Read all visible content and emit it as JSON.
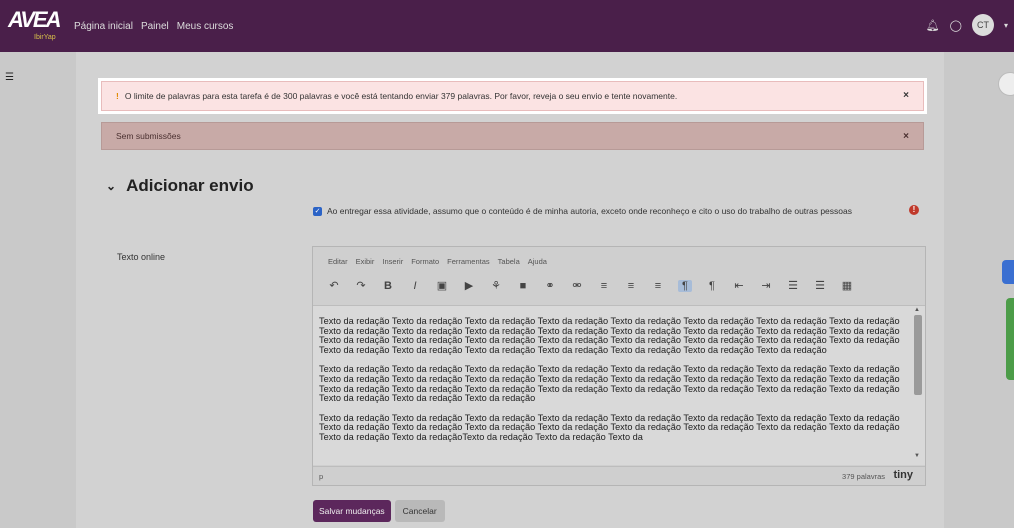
{
  "navbar": {
    "logo_text": "AVEA",
    "logo_sub": "IbirYap",
    "links": [
      "Página inicial",
      "Painel",
      "Meus cursos"
    ],
    "bell_icon": "bell-icon",
    "chat_icon": "chat-icon",
    "avatar_initials": "CT"
  },
  "alerts": {
    "error_text": "O limite de palavras para esta tarefa é de 300 palavras e você está tentando enviar 379 palavras. Por favor, reveja o seu envio e tente novamente.",
    "error_bang": "!",
    "nosub_text": "Sem submissões",
    "close": "×"
  },
  "section": {
    "title": "Adicionar envio",
    "chevron": "⌄"
  },
  "consent": {
    "text": "Ao entregar essa atividade, assumo que o conteúdo é de minha autoria, exceto onde reconheço e cito o uso do trabalho de outras pessoas",
    "required": "!"
  },
  "field": {
    "label": "Texto online"
  },
  "editor": {
    "menu": [
      "Editar",
      "Exibir",
      "Inserir",
      "Formato",
      "Ferramentas",
      "Tabela",
      "Ajuda"
    ],
    "toolbar": [
      "↶",
      "↷",
      "B",
      "I",
      "▣",
      "▶",
      "⚘",
      "■",
      "⚭",
      "⚮",
      "≡",
      "≡",
      "≡",
      "¶",
      "¶",
      "⇤",
      "⇥",
      "☰",
      "☰",
      "▦"
    ],
    "paragraphs": [
      "Texto da redação Texto da redação Texto da redação Texto da redação Texto da redação Texto da redação Texto da redação Texto da redação Texto da redação Texto da redação Texto da redação Texto da redação Texto da redação Texto da redação Texto da redação Texto da redação Texto da redação Texto da redação Texto da redação Texto da redação Texto da redação Texto da redação Texto da redação Texto da redação Texto da redação Texto da redação Texto da redação Texto da redação Texto da redação Texto da redação Texto da redação",
      "Texto da redação Texto da redação Texto da redação Texto da redação Texto da redação Texto da redação Texto da redação Texto da redação Texto da redação Texto da redação Texto da redação Texto da redação Texto da redação Texto da redação Texto da redação Texto da redação Texto da redação Texto da redação Texto da redação Texto da redação Texto da redação Texto da redação Texto da redação Texto da redação Texto da redação Texto da redação Texto da redação",
      "Texto da redação Texto da redação Texto da redação Texto da redação Texto da redação Texto da redação Texto da redação Texto da redação Texto da redação Texto da redação Texto da redação Texto da redação Texto da redação Texto da redação Texto da redação Texto da redação Texto da redação Texto da redaçãoTexto da redação Texto da redação Texto da"
    ],
    "path": "p",
    "wordcount": "379 palavras",
    "brand": "tiny"
  },
  "buttons": {
    "save": "Salvar mudanças",
    "cancel": "Cancelar"
  },
  "colors": {
    "navbar": "#4a1f4a",
    "primary": "#5c275c",
    "error_bg": "#fbe3e3",
    "nosub_bg": "#c8aaa7"
  }
}
